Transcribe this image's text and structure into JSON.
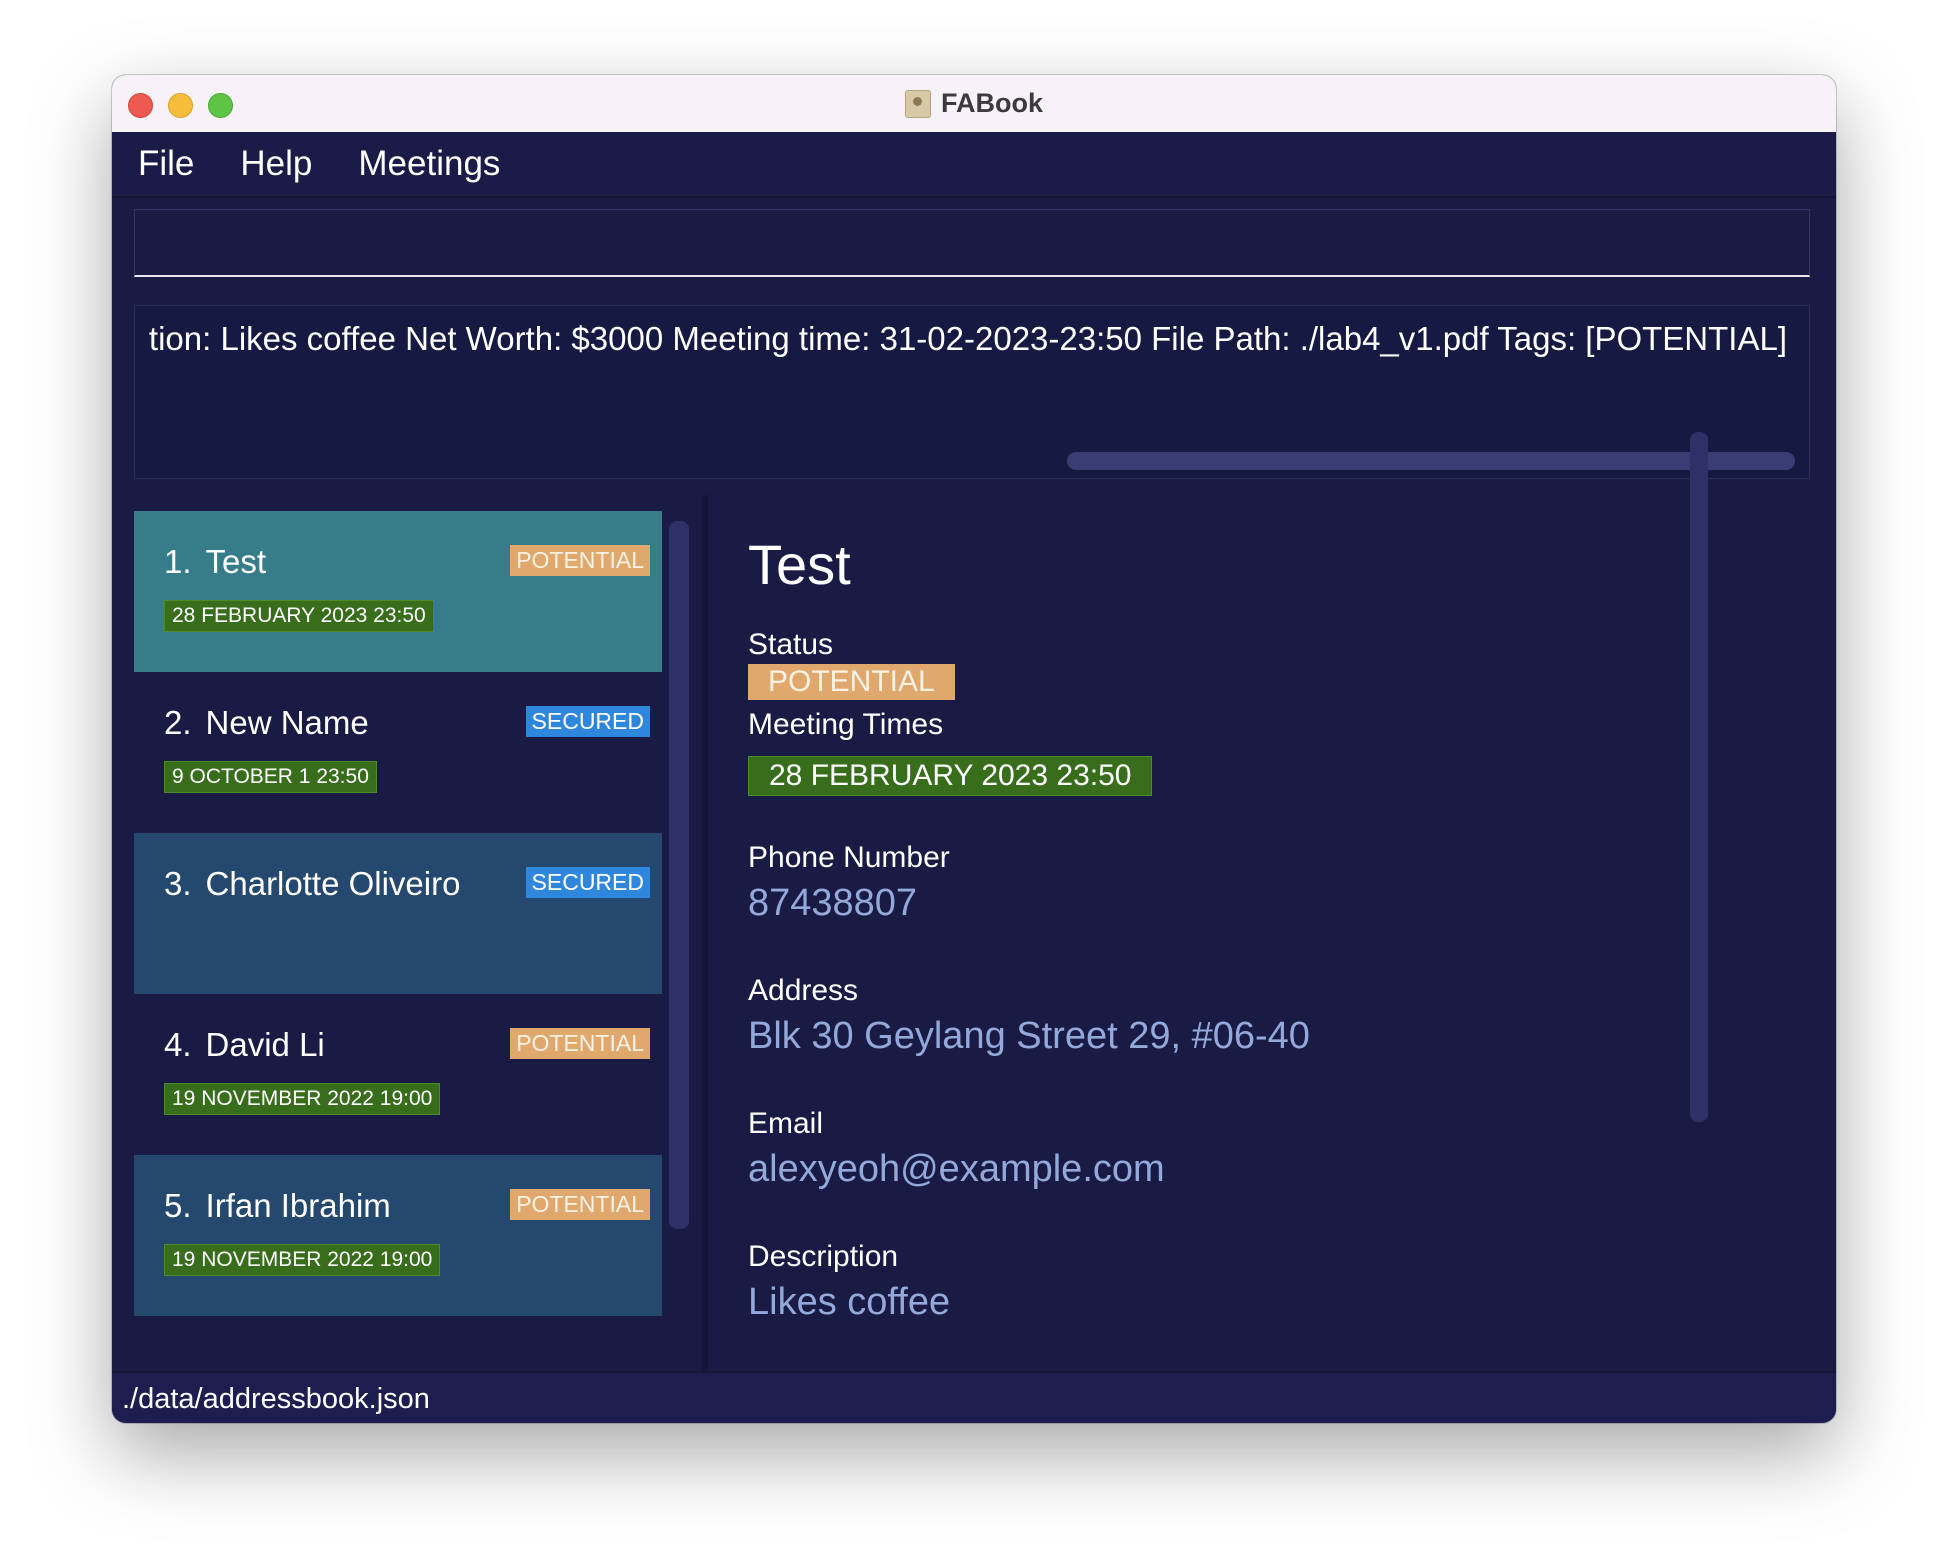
{
  "window": {
    "title": "FABook",
    "app_icon": "contact-book-icon"
  },
  "menu": {
    "items": [
      {
        "label": "File"
      },
      {
        "label": "Help"
      },
      {
        "label": "Meetings"
      }
    ]
  },
  "command": {
    "value": "",
    "placeholder": ""
  },
  "result": {
    "text": "tion: Likes coffee Net Worth: $3000 Meeting time: 31-02-2023-23:50 File Path: ./lab4_v1.pdf Tags: [POTENTIAL]"
  },
  "persons": [
    {
      "index": "1.",
      "name": "Test",
      "tag": "POTENTIAL",
      "meeting": "28 FEBRUARY 2023 23:50"
    },
    {
      "index": "2.",
      "name": "New Name",
      "tag": "SECURED",
      "meeting": "9 OCTOBER 1 23:50"
    },
    {
      "index": "3.",
      "name": "Charlotte Oliveiro",
      "tag": "SECURED",
      "meeting": ""
    },
    {
      "index": "4.",
      "name": "David Li",
      "tag": "POTENTIAL",
      "meeting": "19 NOVEMBER 2022 19:00"
    },
    {
      "index": "5.",
      "name": "Irfan Ibrahim",
      "tag": "POTENTIAL",
      "meeting": "19 NOVEMBER 2022 19:00"
    }
  ],
  "detail": {
    "name": "Test",
    "status_label": "Status",
    "status": "POTENTIAL",
    "meeting_label": "Meeting Times",
    "meeting": "28 FEBRUARY 2023 23:50",
    "phone_label": "Phone Number",
    "phone": "87438807",
    "address_label": "Address",
    "address": "Blk 30 Geylang Street 29, #06-40",
    "email_label": "Email",
    "email": "alexyeoh@example.com",
    "description_label": "Description",
    "description": "Likes coffee"
  },
  "status_bar": {
    "path": "./data/addressbook.json"
  },
  "colors": {
    "background": "#1a1b45",
    "selected_card": "#377c89",
    "alt_card": "#25486f",
    "potential_tag": "#e0a86c",
    "secured_tag": "#2f86dd",
    "meeting_tag": "#386d1c",
    "value_text": "#93a9da"
  }
}
